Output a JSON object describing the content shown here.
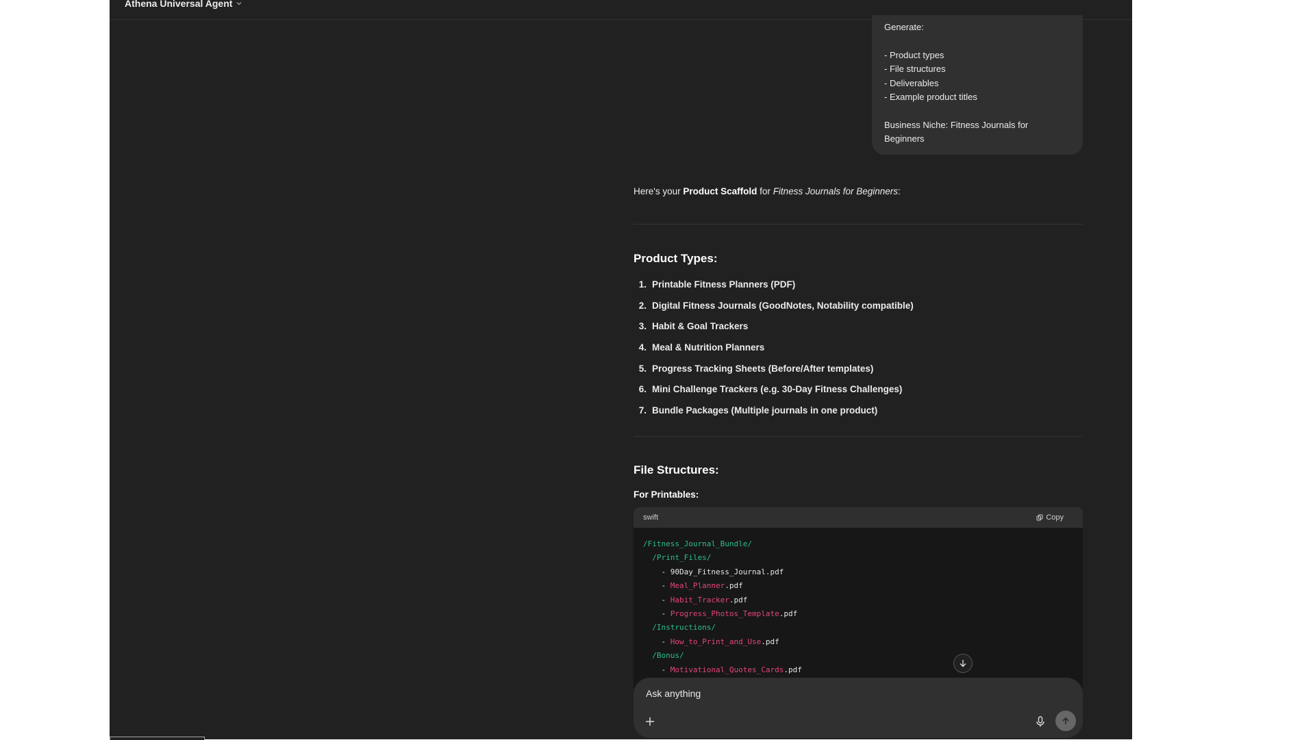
{
  "header": {
    "model_name": "Athena Universal Agent"
  },
  "user_message": {
    "lines": [
      "Generate:",
      "- Product types",
      "- File structures",
      "- Deliverables",
      "- Example product titles",
      "Business Niche: Fitness Journals for Beginners"
    ]
  },
  "assistant": {
    "intro_prefix": "Here's your",
    "intro_bold": "Product Scaffold",
    "intro_for": "for",
    "intro_italic": "Fitness Journals for Beginners",
    "intro_suffix": ":",
    "product_types_heading": "Product Types:",
    "product_types": [
      {
        "num": "1.",
        "text": "Printable Fitness Planners (PDF)"
      },
      {
        "num": "2.",
        "text": "Digital Fitness Journals (GoodNotes, Notability compatible)"
      },
      {
        "num": "3.",
        "text": "Habit & Goal Trackers"
      },
      {
        "num": "4.",
        "text": "Meal & Nutrition Planners"
      },
      {
        "num": "5.",
        "text": "Progress Tracking Sheets (Before/After templates)"
      },
      {
        "num": "6.",
        "text": "Mini Challenge Trackers (e.g. 30-Day Fitness Challenges)"
      },
      {
        "num": "7.",
        "text": "Bundle Packages (Multiple journals in one product)"
      }
    ],
    "file_structures_heading": "File Structures:",
    "for_printables_label": "For Printables:",
    "code_block": {
      "language": "swift",
      "copy_label": "Copy",
      "lines": [
        {
          "indent": "",
          "tokens": [
            {
              "t": "/Fitness_Journal_Bundle/",
              "c": "dir"
            }
          ]
        },
        {
          "indent": "  ",
          "tokens": [
            {
              "t": "/Print_Files/",
              "c": "dir"
            }
          ]
        },
        {
          "indent": "    ",
          "tokens": [
            {
              "t": "- 90Day_Fitness_Journal.pdf",
              "c": "plain"
            }
          ]
        },
        {
          "indent": "    ",
          "tokens": [
            {
              "t": "- ",
              "c": "plain"
            },
            {
              "t": "Meal_Planner",
              "c": "red"
            },
            {
              "t": ".pdf",
              "c": "plain"
            }
          ]
        },
        {
          "indent": "    ",
          "tokens": [
            {
              "t": "- ",
              "c": "plain"
            },
            {
              "t": "Habit_Tracker",
              "c": "red"
            },
            {
              "t": ".pdf",
              "c": "plain"
            }
          ]
        },
        {
          "indent": "    ",
          "tokens": [
            {
              "t": "- ",
              "c": "plain"
            },
            {
              "t": "Progress_Photos_Template",
              "c": "red"
            },
            {
              "t": ".pdf",
              "c": "plain"
            }
          ]
        },
        {
          "indent": "  ",
          "tokens": [
            {
              "t": "/Instructions/",
              "c": "dir"
            }
          ]
        },
        {
          "indent": "    ",
          "tokens": [
            {
              "t": "- ",
              "c": "plain"
            },
            {
              "t": "How_to_Print_and_Use",
              "c": "red"
            },
            {
              "t": ".pdf",
              "c": "plain"
            }
          ]
        },
        {
          "indent": "  ",
          "tokens": [
            {
              "t": "/Bonus/",
              "c": "dir"
            }
          ]
        },
        {
          "indent": "    ",
          "tokens": [
            {
              "t": "- ",
              "c": "plain"
            },
            {
              "t": "Motivational_Quotes_Cards",
              "c": "red"
            },
            {
              "t": ".pdf",
              "c": "plain"
            }
          ]
        }
      ]
    }
  },
  "composer": {
    "placeholder": "Ask anything"
  },
  "icons": {
    "model_chevron": "chevron-down-icon",
    "copy": "copy-icon",
    "scroll_down": "arrow-down-icon",
    "plus": "plus-icon",
    "mic": "microphone-icon",
    "send": "arrow-up-icon"
  },
  "colors": {
    "background": "#212121",
    "bubble": "#303030",
    "code_bg": "#171717",
    "code_dir": "#2bbf8a",
    "code_red": "#e2457a"
  }
}
